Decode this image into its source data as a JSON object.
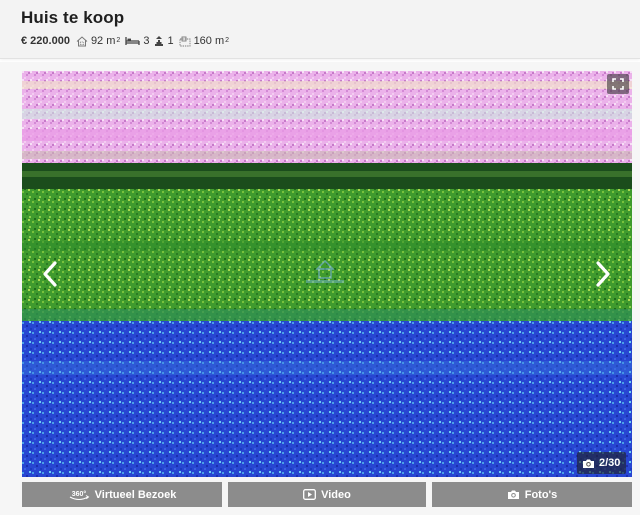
{
  "listing": {
    "title": "Huis te koop",
    "price": "€ 220.000",
    "living_area": "92 m",
    "living_area_unit_sup": "2",
    "bedrooms": "3",
    "floors": "1",
    "plot_area": "160 m",
    "plot_area_unit_sup": "2"
  },
  "gallery": {
    "counter": "2/30",
    "icons": {
      "fullscreen": "fullscreen-icon",
      "prev": "chevron-left-icon",
      "next": "chevron-right-icon",
      "camera": "camera-icon"
    }
  },
  "actions": {
    "virtual_tour": "Virtueel Bezoek",
    "virtual_tour_badge": "360°",
    "video": "Video",
    "photos": "Foto's"
  },
  "colors": {
    "header_bg": "#f3f3f3",
    "button_bg": "#8c8c8c",
    "sky": "#e9a6e6",
    "field": "#3f9a2e",
    "water": "#2a48d6"
  }
}
